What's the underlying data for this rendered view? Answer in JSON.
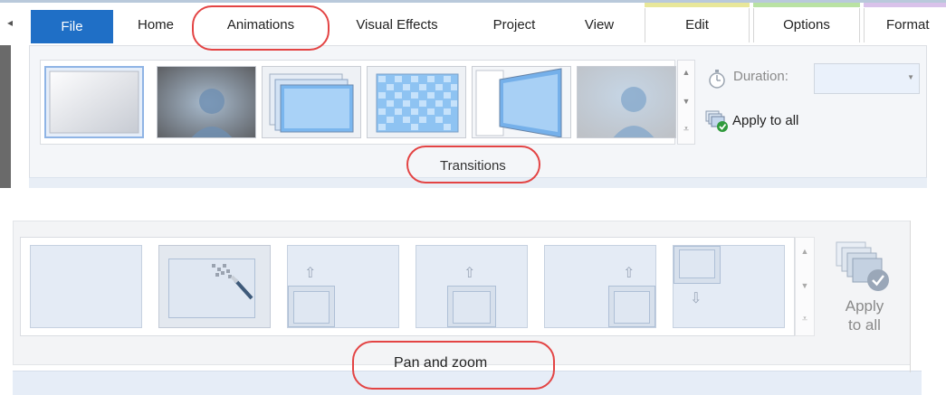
{
  "tabs": {
    "file": "File",
    "home": "Home",
    "animations": "Animations",
    "visual_effects": "Visual Effects",
    "project": "Project",
    "view": "View",
    "edit": "Edit",
    "options": "Options",
    "format": "Format"
  },
  "transitions": {
    "group_label": "Transitions",
    "duration_label": "Duration:",
    "duration_value": "",
    "apply_to_all_label": "Apply to all",
    "thumbnails": [
      "no-transition",
      "crossfade",
      "layered-panels",
      "checkerboard",
      "flip-angle",
      "fade-portrait"
    ],
    "selected_index": 0
  },
  "pan_and_zoom": {
    "group_label": "Pan and zoom",
    "apply_to_all_label": "Apply\nto all",
    "thumbnails": [
      "no-pan-zoom",
      "automatic",
      "pan-up-left",
      "pan-up-center",
      "pan-up-right",
      "pan-down-left"
    ],
    "selected_index": 1
  },
  "colors": {
    "file_tab": "#1f6fc6",
    "highlight_oval": "#e34444",
    "edit_context": "#e8e79a",
    "options_context": "#b9e2a3",
    "format_context": "#d9c2ea"
  }
}
